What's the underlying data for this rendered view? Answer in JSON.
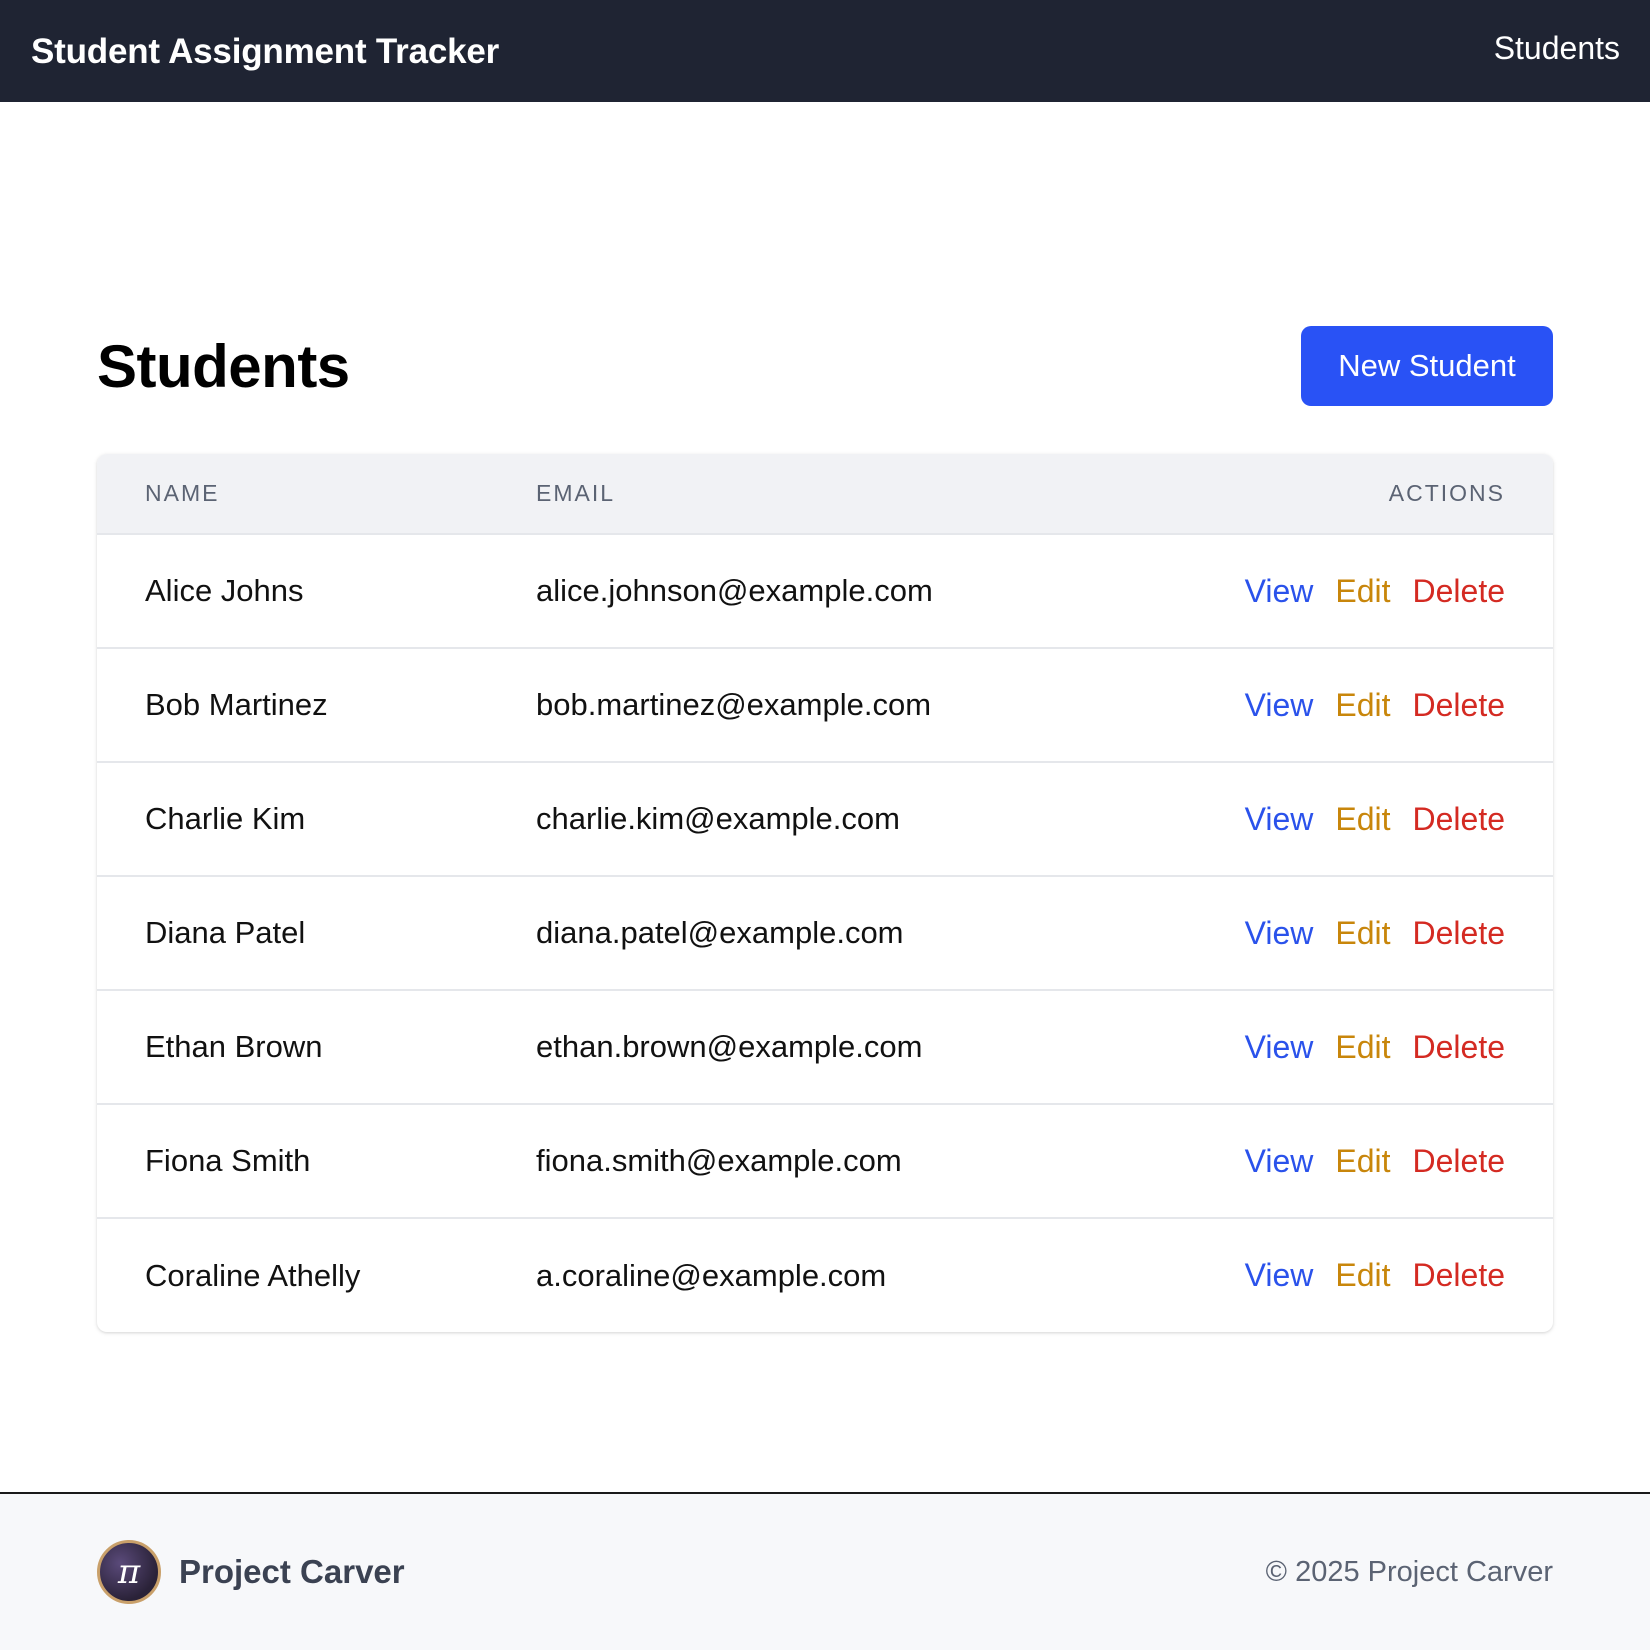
{
  "header": {
    "brand": "Student Assignment Tracker",
    "nav_students": "Students"
  },
  "main": {
    "title": "Students",
    "new_button": "New Student"
  },
  "table": {
    "columns": [
      "NAME",
      "EMAIL",
      "ACTIONS"
    ],
    "rows": [
      {
        "name": "Alice Johns",
        "email": "alice.johnson@example.com"
      },
      {
        "name": "Bob Martinez",
        "email": "bob.martinez@example.com"
      },
      {
        "name": "Charlie Kim",
        "email": "charlie.kim@example.com"
      },
      {
        "name": "Diana Patel",
        "email": "diana.patel@example.com"
      },
      {
        "name": "Ethan Brown",
        "email": "ethan.brown@example.com"
      },
      {
        "name": "Fiona Smith",
        "email": "fiona.smith@example.com"
      },
      {
        "name": "Coraline Athelly",
        "email": "a.coraline@example.com"
      }
    ],
    "actions": {
      "view": "View",
      "edit": "Edit",
      "delete": "Delete"
    }
  },
  "footer": {
    "logo_icon": "pi-logo-icon",
    "logo_glyph": "π",
    "name": "Project Carver",
    "copyright": "© 2025 Project Carver"
  },
  "colors": {
    "topbar": "#1f2433",
    "primary": "#2952f5",
    "view": "#2a52eb",
    "edit": "#c8860b",
    "delete": "#d42a22"
  }
}
